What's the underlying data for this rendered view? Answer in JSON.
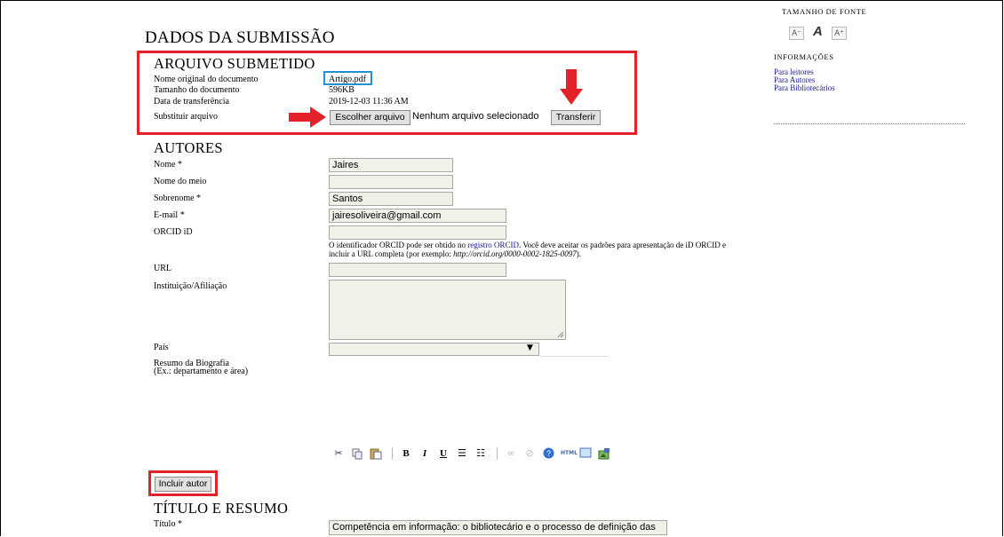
{
  "page_title": "DADOS DA SUBMISSÃO",
  "file_section": {
    "heading": "ARQUIVO SUBMETIDO",
    "labels": {
      "original_name": "Nome original do documento",
      "size": "Tamanho do documento",
      "date": "Data de transferência",
      "replace": "Substituir arquivo"
    },
    "values": {
      "original_name": "Artigo.pdf",
      "size": "596KB",
      "date": "2019-12-03 11:36 AM"
    },
    "choose_button": "Escolher arquivo",
    "no_file_text": "Nenhum arquivo selecionado",
    "upload_button": "Transferir"
  },
  "authors_section": {
    "heading": "AUTORES",
    "labels": {
      "first_name": "Nome *",
      "middle_name": "Nome do meio",
      "last_name": "Sobrenome *",
      "email": "E-mail *",
      "orcid": "ORCID iD",
      "url": "URL",
      "affiliation": "Instituição/Afiliação",
      "country": "País",
      "bio": "Resumo da Biografia",
      "bio_hint": "(Ex.: departamento e área)"
    },
    "values": {
      "first_name": "Jaires",
      "middle_name": "",
      "last_name": "Santos",
      "email": "jairesoliveira@gmail.com",
      "orcid": "",
      "url": "",
      "country": ""
    },
    "orcid_help": {
      "part1": "O identificador ORCID pode ser obtido no ",
      "link": "registro ORCID",
      "part2": ". Você deve aceitar os padrões para apresentação de iD ORCID e incluir a URL completa (por exemplo: ",
      "example": "http://orcid.org/0000-0002-1825-0097",
      "part3": ")."
    },
    "include_author_button": "Incluir autor"
  },
  "title_section": {
    "heading": "TÍTULO E RESUMO",
    "title_label": "Título *",
    "title_value": "Competência em informação: o bibliotecário e o processo de definição das"
  },
  "sidebar": {
    "font_size_heading": "TAMANHO DE FONTE",
    "font_buttons": [
      "A⁻",
      "A",
      "A⁺"
    ],
    "info_heading": "INFORMAÇÕES",
    "links": [
      "Para leitores",
      "Para Autores",
      "Para Bibliotecários"
    ]
  },
  "toolbar_icons": [
    "cut-icon",
    "copy-icon",
    "paste-icon",
    "bold-icon",
    "italic-icon",
    "underline-icon",
    "unordered-list-icon",
    "ordered-list-icon",
    "link-icon",
    "unlink-icon",
    "help-icon",
    "html-icon",
    "fullscreen-icon",
    "image-icon"
  ],
  "colors": {
    "annotation_red": "#e32129",
    "annotation_blue": "#1e90d6",
    "link": "#1a1a8c",
    "input_bg": "#f1f0e9"
  }
}
